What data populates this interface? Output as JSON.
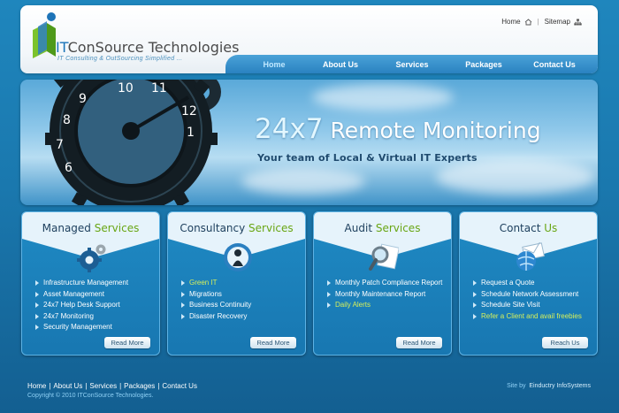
{
  "header": {
    "logo_prefix": "IT",
    "logo_rest": "ConSource Technologies",
    "tagline": "IT Consulting & OutSourcing Simplified ...",
    "toplinks": {
      "home": "Home",
      "sitemap": "Sitemap"
    }
  },
  "nav": {
    "items": [
      {
        "label": "Home",
        "active": true
      },
      {
        "label": "About Us",
        "active": false
      },
      {
        "label": "Services",
        "active": false
      },
      {
        "label": "Packages",
        "active": false
      },
      {
        "label": "Contact Us",
        "active": false
      }
    ]
  },
  "banner": {
    "title_num": "24x7",
    "title_rest": " Remote Monitoring",
    "subtitle": "Your team of Local & Virtual IT Experts",
    "clock_numbers": [
      "7",
      "8",
      "9",
      "10",
      "11",
      "12",
      "1",
      "6"
    ]
  },
  "boxes": [
    {
      "title_a": "Managed ",
      "title_b": "Services",
      "icon": "gears-icon",
      "items": [
        "Infrastructure Management",
        "Asset Management",
        "24x7 Help Desk Support",
        "24x7 Monitoring",
        "Security Management"
      ],
      "button": "Read More"
    },
    {
      "title_a": "Consultancy ",
      "title_b": "Services",
      "icon": "consultant-icon",
      "items": [
        "Green IT",
        "Migrations",
        "Business Continuity",
        "Disaster Recovery"
      ],
      "button": "Read More"
    },
    {
      "title_a": "Audit ",
      "title_b": "Services",
      "icon": "magnifier-icon",
      "items": [
        "Monthly Patch Compliance Report",
        "Monthly Maintenance Report",
        "Daily Alerts"
      ],
      "button": "Read More"
    },
    {
      "title_a": "Contact ",
      "title_b": "Us",
      "icon": "mail-globe-icon",
      "items": [
        "Request a Quote",
        "Schedule Network Assessment",
        "Schedule Site Visit",
        "Refer a Client and avail freebies"
      ],
      "button": "Reach Us"
    }
  ],
  "footer": {
    "links": [
      "Home",
      "About Us",
      "Services",
      "Packages",
      "Contact Us"
    ],
    "copyright": "Copyright © 2010 ITConSource Technologies.",
    "siteby_label": "Site by",
    "siteby_name": "Einductry InfoSystems"
  },
  "colors": {
    "background": "#1a78ae",
    "accent_green": "#69a614",
    "highlight_yellow": "#d6ef5a",
    "nav_active": "#bfe8ff"
  }
}
